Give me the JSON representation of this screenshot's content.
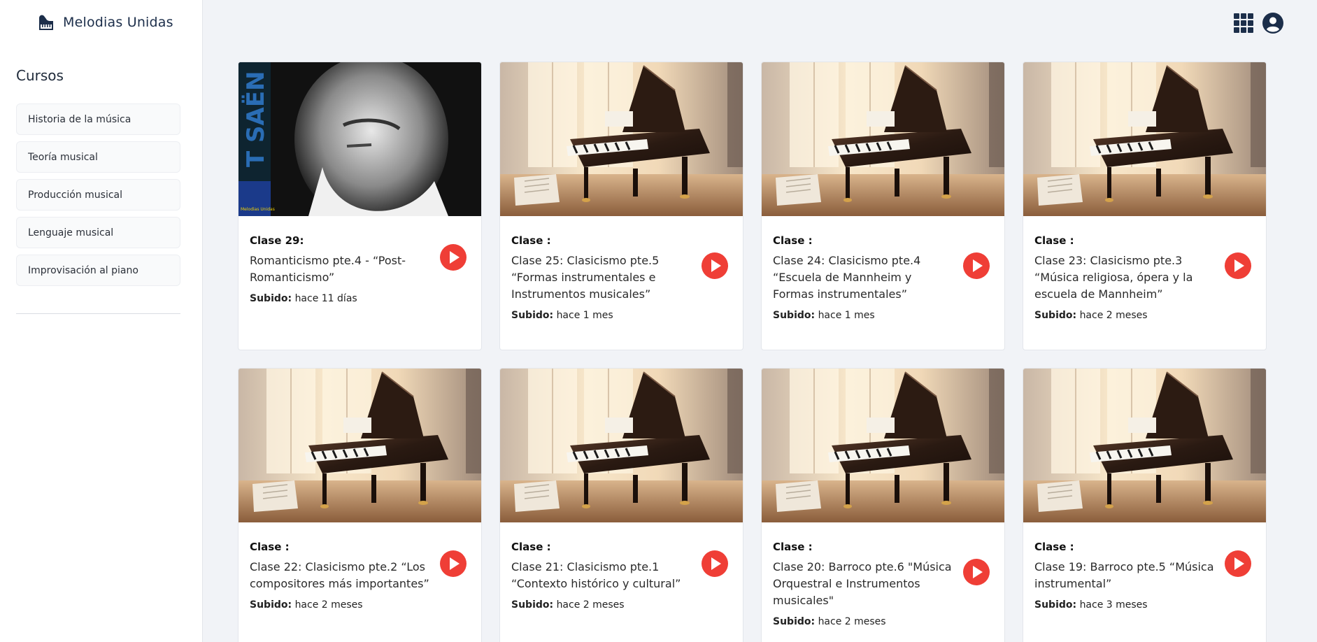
{
  "brand": {
    "name": "Melodias Unidas",
    "icon": "piano-icon"
  },
  "sidebar": {
    "title": "Cursos",
    "items": [
      {
        "label": "Historia de la música"
      },
      {
        "label": "Teoría musical"
      },
      {
        "label": "Producción musical"
      },
      {
        "label": "Lenguaje musical"
      },
      {
        "label": "Improvisación al piano"
      }
    ]
  },
  "topbar": {
    "apps_icon": "grid-apps-icon",
    "account_icon": "user-circle-icon"
  },
  "colors": {
    "play": "#ef3e36",
    "brand": "#1c2e4a",
    "background": "#f1f3f7"
  },
  "uploaded_label": "Subido:",
  "cards": [
    {
      "head": "Clase 29:",
      "title": "Romanticismo pte.4 - “Post-Romanticismo”",
      "uploaded": "hace 11 días",
      "thumb": "portrait",
      "thumb_text": "T SAËN",
      "thumb_logo_text": "Melodias Unidas"
    },
    {
      "head": "Clase :",
      "title": "Clase 25: Clasicismo pte.5 “Formas instrumentales e Instrumentos musicales”",
      "uploaded": "hace 1 mes",
      "thumb": "piano"
    },
    {
      "head": "Clase :",
      "title": "Clase 24: Clasicismo pte.4 “Escuela de Mannheim y Formas instrumentales”",
      "uploaded": "hace 1 mes",
      "thumb": "piano"
    },
    {
      "head": "Clase :",
      "title": "Clase 23: Clasicismo pte.3 “Música religiosa, ópera y la escuela de Mannheim”",
      "uploaded": "hace 2 meses",
      "thumb": "piano"
    },
    {
      "head": "Clase :",
      "title": "Clase 22: Clasicismo pte.2 “Los compositores más importantes”",
      "uploaded": "hace 2 meses",
      "thumb": "piano"
    },
    {
      "head": "Clase :",
      "title": "Clase 21: Clasicismo pte.1 “Contexto histórico y cultural”",
      "uploaded": "hace 2 meses",
      "thumb": "piano"
    },
    {
      "head": "Clase :",
      "title": "Clase 20: Barroco pte.6 \"Música Orquestral e Instrumentos musicales\"",
      "uploaded": "hace 2 meses",
      "thumb": "piano"
    },
    {
      "head": "Clase :",
      "title": "Clase 19: Barroco pte.5 “Música instrumental”",
      "uploaded": "hace 3 meses",
      "thumb": "piano"
    }
  ]
}
